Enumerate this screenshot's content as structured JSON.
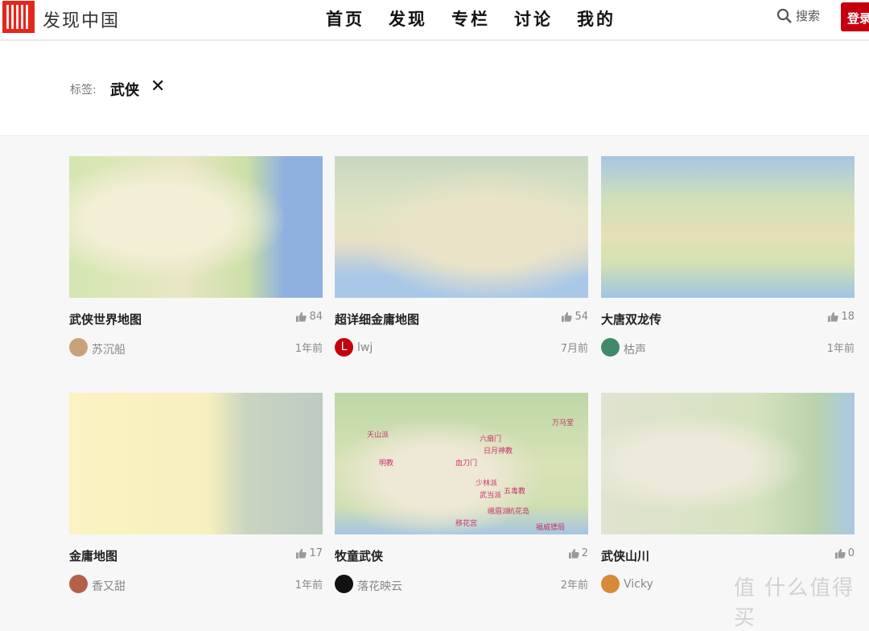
{
  "header": {
    "brand": "发现中国",
    "nav": [
      "首页",
      "发现",
      "专栏",
      "讨论",
      "我的"
    ],
    "search": "搜索",
    "login": "登录"
  },
  "tag": {
    "label": "标签:",
    "value": "武侠",
    "clear": "✕"
  },
  "cards": [
    {
      "title": "武侠世界地图",
      "likes": "84",
      "author": "苏沉船",
      "time": "1年前",
      "avatar_color": "#c9a27a",
      "avatar_letter": ""
    },
    {
      "title": "超详细金庸地图",
      "likes": "54",
      "author": "lwj",
      "time": "7月前",
      "avatar_color": "#c4000f",
      "avatar_letter": "L"
    },
    {
      "title": "大唐双龙传",
      "likes": "18",
      "author": "枯声",
      "time": "1年前",
      "avatar_color": "#3f8a6a",
      "avatar_letter": ""
    },
    {
      "title": "金庸地图",
      "likes": "17",
      "author": "香又甜",
      "time": "1年前",
      "avatar_color": "#b5614a",
      "avatar_letter": ""
    },
    {
      "title": "牧童武侠",
      "likes": "2",
      "author": "落花映云",
      "time": "2年前",
      "avatar_color": "#111111",
      "avatar_letter": ""
    },
    {
      "title": "武侠山川",
      "likes": "0",
      "author": "Vicky",
      "time": "",
      "avatar_color": "#d9893a",
      "avatar_letter": ""
    }
  ],
  "map_labels": {
    "t4": [
      "天山派",
      "明教",
      "血刀门",
      "六扇门",
      "日月神教",
      "少林派",
      "武当派",
      "峨眉派",
      "五毒教",
      "杭花岛",
      "移花宫",
      "福威镖局",
      "万马堂"
    ]
  },
  "watermark": "值 什么值得买"
}
